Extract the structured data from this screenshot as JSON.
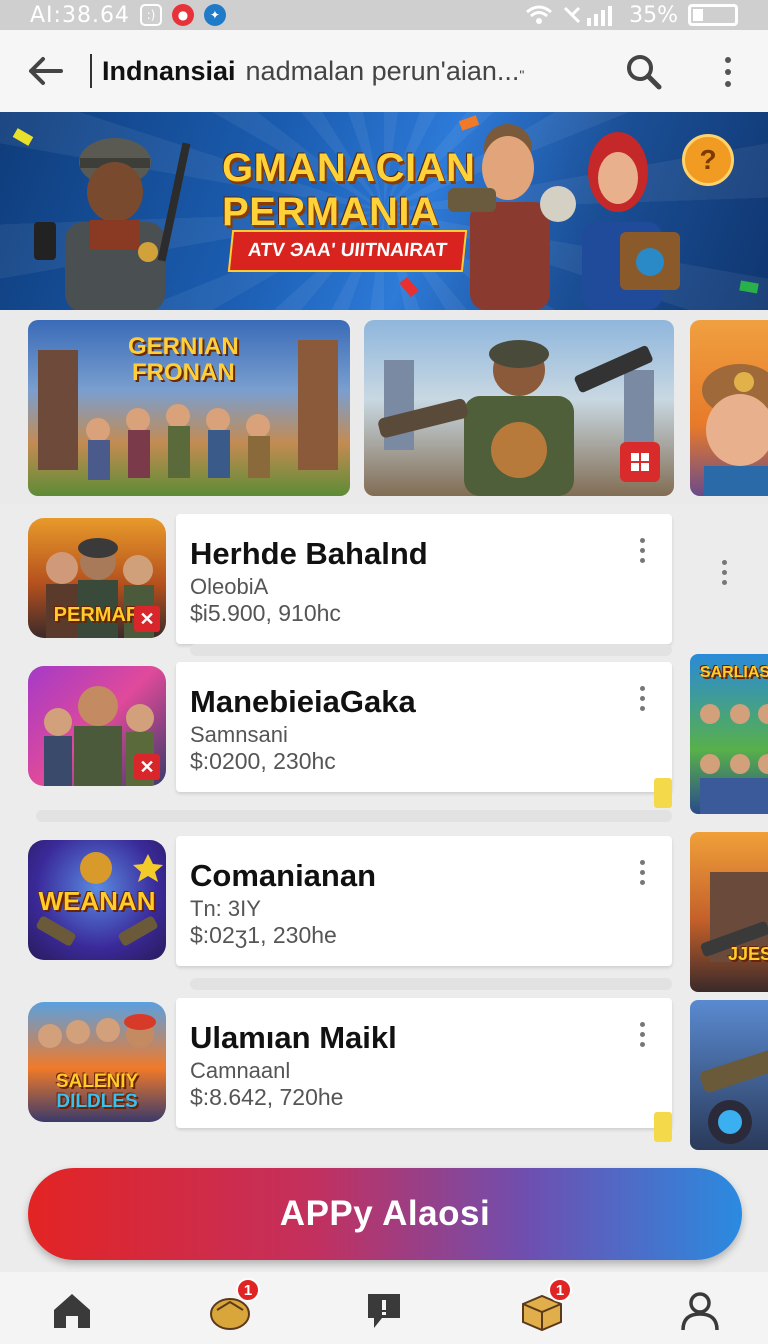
{
  "status_bar": {
    "time": "AI:38.64",
    "battery": "35%"
  },
  "header": {
    "title": "Indnansiai",
    "subtitle": "nadmalan perun'aian...",
    "subtitle_mark": "\"",
    "back_icon": "arrow-left-icon",
    "search_icon": "search-icon",
    "more_icon": "more-vertical-icon"
  },
  "hero": {
    "title_line1": "GMANACIAN",
    "title_line2": "PERMANIA",
    "tag": "ATV ЭAA' UIITNAIRAT",
    "bubble": "?"
  },
  "carousel": [
    {
      "title_line1": "GERNIAN",
      "title_line2": "FRONAN"
    },
    {
      "title": ""
    },
    {
      "title": ""
    }
  ],
  "items": [
    {
      "name": "Herhde Bahalnd",
      "meta": "OleobiA",
      "price": "$i5.900, 910hc",
      "badge": "x",
      "thumb_text": "PERMAR"
    },
    {
      "name": "ManebieiaGaka",
      "meta": "Samnsani",
      "price": "$:0200, 230hc",
      "badge": "x",
      "thumb_text": ""
    },
    {
      "name": "Comanianan",
      "meta": "Tn: 3IY",
      "price": "$:02ʒ1, 230he",
      "badge": "",
      "thumb_text": "WEANAN"
    },
    {
      "name": "Ulamıan Maikl",
      "meta": "Camnaanl",
      "price": "$:8.642, 720he",
      "badge": "",
      "thumb_text_1": "SALENIY",
      "thumb_text_2": "DILDLES"
    }
  ],
  "side": {
    "text1": "SARLIAS",
    "text2": "JJES"
  },
  "cta": {
    "label": "APPy Alaosi"
  },
  "bottom_nav": [
    {
      "icon": "home-icon",
      "badge": ""
    },
    {
      "icon": "shop-bag-icon",
      "badge": "1"
    },
    {
      "icon": "chat-icon",
      "badge": ""
    },
    {
      "icon": "package-icon",
      "badge": "1"
    },
    {
      "icon": "profile-icon",
      "badge": ""
    }
  ],
  "colors": {
    "cta_start": "#e32424",
    "cta_end": "#2a8be0",
    "badge_red": "#e02323",
    "title_gold": "#ffd23a"
  }
}
